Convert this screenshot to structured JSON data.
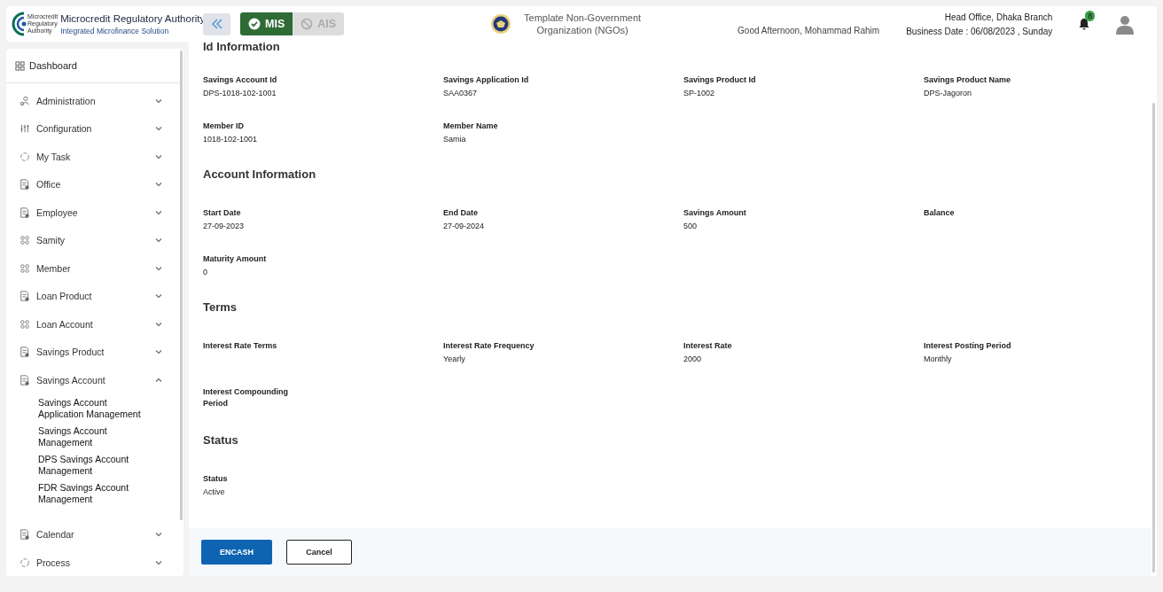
{
  "header": {
    "logo_text": [
      "Microcredit",
      "Regulatory",
      "Authority"
    ],
    "title": "Microcredit Regulatory Authority",
    "subtitle": "Integrated Microfinance Solution",
    "modules": [
      {
        "label": "MIS",
        "selected": true
      },
      {
        "label": "AIS",
        "selected": false
      }
    ],
    "organization": "Template Non-Government Organization (NGOs)",
    "greeting": "Good Afternoon, Mohammad Rahim",
    "branch": "Head Office, Dhaka Branch",
    "business_date": "Business Date : 06/08/2023 , Sunday",
    "notifications": "8"
  },
  "sidebar": {
    "dashboard": "Dashboard",
    "items": [
      {
        "label": "Administration",
        "expanded": false
      },
      {
        "label": "Configuration",
        "expanded": false
      },
      {
        "label": "My Task",
        "expanded": false
      },
      {
        "label": "Office",
        "expanded": false
      },
      {
        "label": "Employee",
        "expanded": false
      },
      {
        "label": "Samity",
        "expanded": false
      },
      {
        "label": "Member",
        "expanded": false
      },
      {
        "label": "Loan Product",
        "expanded": false
      },
      {
        "label": "Loan Account",
        "expanded": false
      },
      {
        "label": "Savings Product",
        "expanded": false
      },
      {
        "label": "Savings Account",
        "expanded": true,
        "children": [
          "Savings Account Application Management",
          "Savings Account Management",
          "DPS Savings Account Management",
          "FDR Savings Account Management"
        ]
      },
      {
        "label": "Calendar",
        "expanded": false
      },
      {
        "label": "Process",
        "expanded": false
      }
    ]
  },
  "sections": [
    {
      "title": "Id Information",
      "fields": [
        {
          "label": "Savings Account Id",
          "value": "DPS-1018-102-1001"
        },
        {
          "label": "Savings Application Id",
          "value": "SAA0367"
        },
        {
          "label": "Savings Product Id",
          "value": "SP-1002"
        },
        {
          "label": "Savings Product Name",
          "value": "DPS-Jagoron"
        },
        {
          "label": "Member ID",
          "value": "1018-102-1001"
        },
        {
          "label": "Member Name",
          "value": "Samia"
        }
      ]
    },
    {
      "title": "Account Information",
      "fields": [
        {
          "label": "Start Date",
          "value": "27-09-2023"
        },
        {
          "label": "End Date",
          "value": "27-09-2024"
        },
        {
          "label": "Savings Amount",
          "value": "500"
        },
        {
          "label": "Balance"
        },
        {
          "label": "Maturity Amount",
          "value": "0"
        }
      ]
    },
    {
      "title": "Terms",
      "fields": [
        {
          "label": "Interest Rate Terms"
        },
        {
          "label": "Interest Rate Frequency",
          "value": "Yearly"
        },
        {
          "label": "Interest Rate",
          "value": "2000"
        },
        {
          "label": "Interest Posting Period",
          "value": "Monthly"
        },
        {
          "label": "Interest Compounding Period"
        }
      ]
    },
    {
      "title": "Status",
      "fields": [
        {
          "label": "Status",
          "value": "Active"
        }
      ]
    }
  ],
  "buttons": {
    "primary": "ENCASH",
    "secondary": "Cancel"
  }
}
